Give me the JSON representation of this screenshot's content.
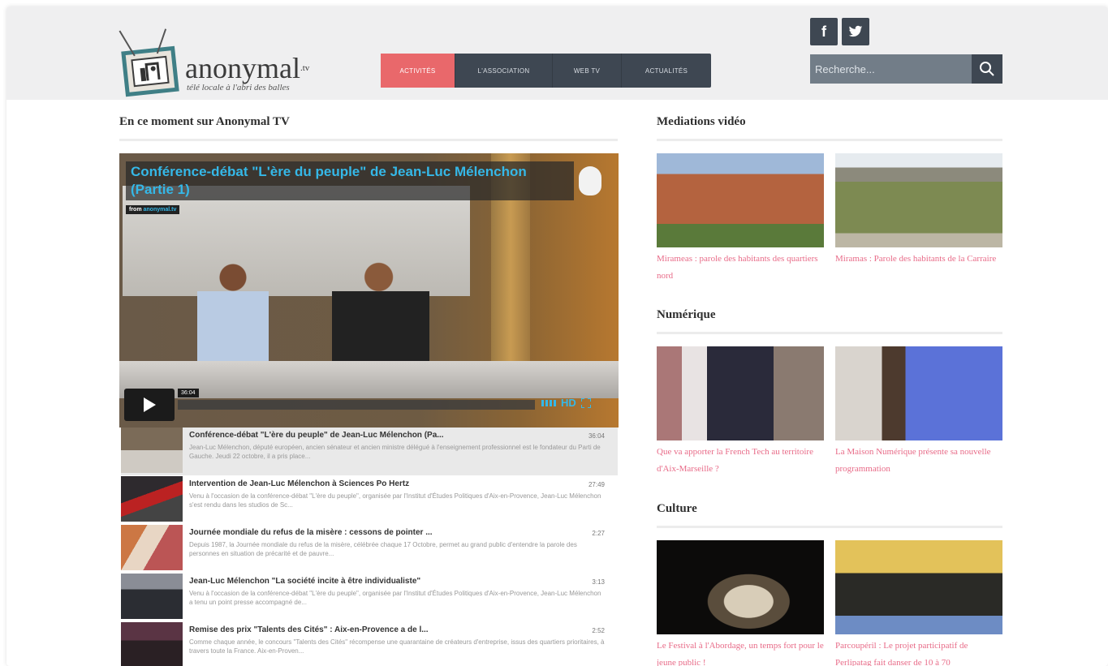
{
  "logo": {
    "name": "anonymal",
    "suffix": ".tv",
    "tagline": "télé locale à l'abri des balles"
  },
  "nav": {
    "items": [
      {
        "label": "ACTIVITÉS",
        "active": true
      },
      {
        "label": "L'ASSOCIATION",
        "active": false
      },
      {
        "label": "WEB TV",
        "active": false
      },
      {
        "label": "ACTUALITÉS",
        "active": false
      }
    ]
  },
  "social": {
    "facebook": "f",
    "twitter": "t"
  },
  "search": {
    "placeholder": "Recherche..."
  },
  "main": {
    "section_title": "En ce moment sur Anonymal TV",
    "player": {
      "title": "Conférence-débat \"L'ère du peuple\" de Jean-Luc Mélenchon (Partie 1)",
      "from_label": "from",
      "from_source": "anonymal.tv",
      "time": "36:04",
      "hd_label": "HD"
    },
    "playlist": [
      {
        "title": "Conférence-débat \"L'ère du peuple\" de Jean-Luc Mélenchon (Pa...",
        "duration": "36:04",
        "desc": "Jean-Luc Mélenchon, député européen, ancien sénateur et ancien ministre délégué à l'enseignement professionnel est le fondateur du Parti de Gauche. Jeudi 22 octobre, il a pris place..."
      },
      {
        "title": "Intervention de Jean-Luc Mélenchon à Sciences Po Hertz",
        "duration": "27:49",
        "desc": "Venu à l'occasion de la conférence-débat \"L'ère du peuple\", organisée par l'Institut d'Études Politiques d'Aix-en-Provence, Jean-Luc Mélenchon s'est rendu dans les studios de Sc..."
      },
      {
        "title": "Journée mondiale du refus de la misère : cessons de pointer ...",
        "duration": "2:27",
        "desc": "Depuis 1987, la Journée mondiale du refus de la misère, célébrée chaque 17 Octobre, permet au grand public d'entendre la parole des personnes en situation de précarité et de pauvre..."
      },
      {
        "title": "Jean-Luc Mélenchon \"La société incite à être individualiste\"",
        "duration": "3:13",
        "desc": "Venu à l'occasion de la conférence-débat \"L'ère du peuple\", organisée par l'Institut d'Études Politiques d'Aix-en-Provence, Jean-Luc Mélenchon a tenu un point presse accompagné de..."
      },
      {
        "title": "Remise des prix \"Talents des Cités\" : Aix-en-Provence a de l...",
        "duration": "2:52",
        "desc": "Comme chaque année, le concours \"Talents des Cités\" récompense une quarantaine de créateurs d'entreprise, issus des quartiers prioritaires, à travers toute la France. Aix-en-Proven..."
      }
    ]
  },
  "sidebar": {
    "sections": [
      {
        "title": "Mediations vidéo",
        "cards": [
          {
            "caption": "Mirameas : parole des habitants des quartiers nord"
          },
          {
            "caption": "Miramas : Parole des habitants de la Carraire"
          }
        ]
      },
      {
        "title": "Numérique",
        "cards": [
          {
            "caption": "Que va apporter la French Tech au territoire d'Aix-Marseille ?"
          },
          {
            "caption": "La Maison Numérique présente sa nouvelle programmation"
          }
        ]
      },
      {
        "title": "Culture",
        "cards": [
          {
            "caption": "Le Festival à l'Abordage, un temps fort pour le jeune public !"
          },
          {
            "caption": "Parcoupéril : Le projet participatif de Perlipatag fait danser de 10 à 70"
          }
        ]
      }
    ]
  },
  "colors": {
    "accent": "#e9686b",
    "nav_bg": "#3e4752",
    "link_pink": "#e86b88",
    "player_blue": "#35b8e8"
  }
}
